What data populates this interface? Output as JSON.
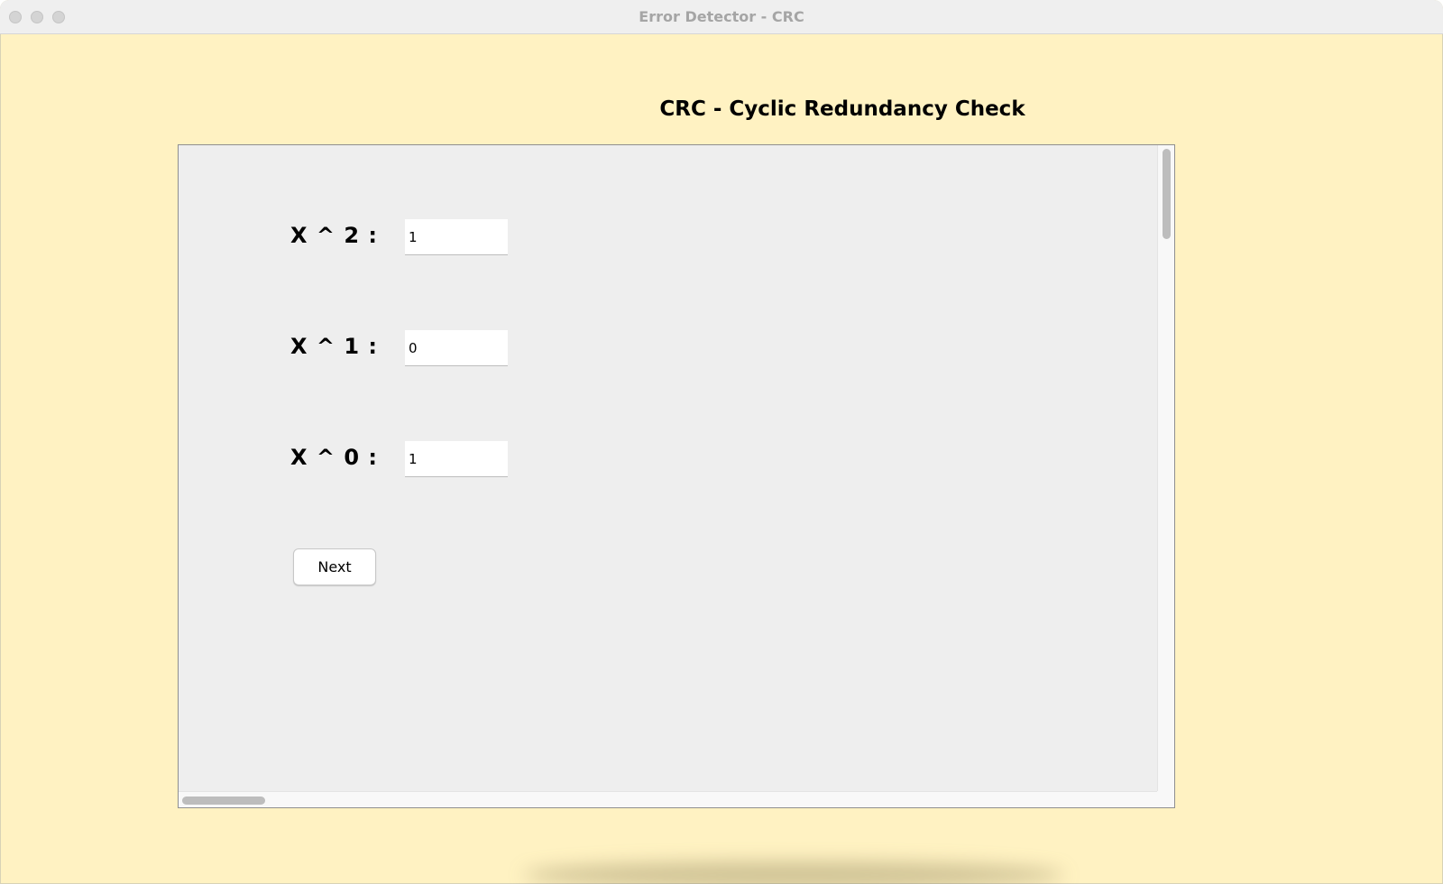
{
  "window": {
    "title": "Error Detector -  CRC"
  },
  "heading": "CRC - Cyclic Redundancy Check",
  "form": {
    "rows": [
      {
        "label": "X ^ 2 :",
        "value": "1"
      },
      {
        "label": "X ^ 1 :",
        "value": "0"
      },
      {
        "label": "X ^ 0 :",
        "value": "1"
      }
    ],
    "next_label": "Next"
  },
  "colors": {
    "window_background": "#fff2c2",
    "panel_background": "#eeeeee",
    "titlebar": "#efefef"
  }
}
